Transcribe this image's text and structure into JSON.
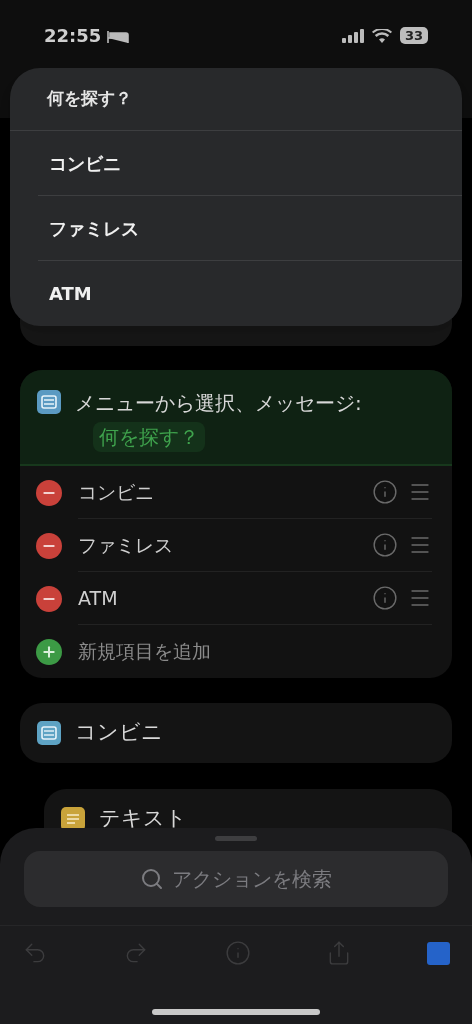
{
  "status_bar": {
    "time": "22:55",
    "battery": "33"
  },
  "menu": {
    "title": "何を探す？",
    "items": [
      {
        "label": "コンビニ"
      },
      {
        "label": "ファミレス"
      },
      {
        "label": "ATM"
      }
    ]
  },
  "choose_action": {
    "title": "メニューから選択、メッセージ:",
    "prompt": "何を探す？",
    "items": [
      {
        "label": "コンビニ",
        "kind": "remove"
      },
      {
        "label": "ファミレス",
        "kind": "remove"
      },
      {
        "label": "ATM",
        "kind": "remove"
      },
      {
        "label": "新規項目を追加",
        "kind": "add"
      }
    ]
  },
  "case_action": {
    "title": "コンビニ"
  },
  "text_action": {
    "title": "テキスト"
  },
  "search": {
    "placeholder": "アクションを検索"
  }
}
